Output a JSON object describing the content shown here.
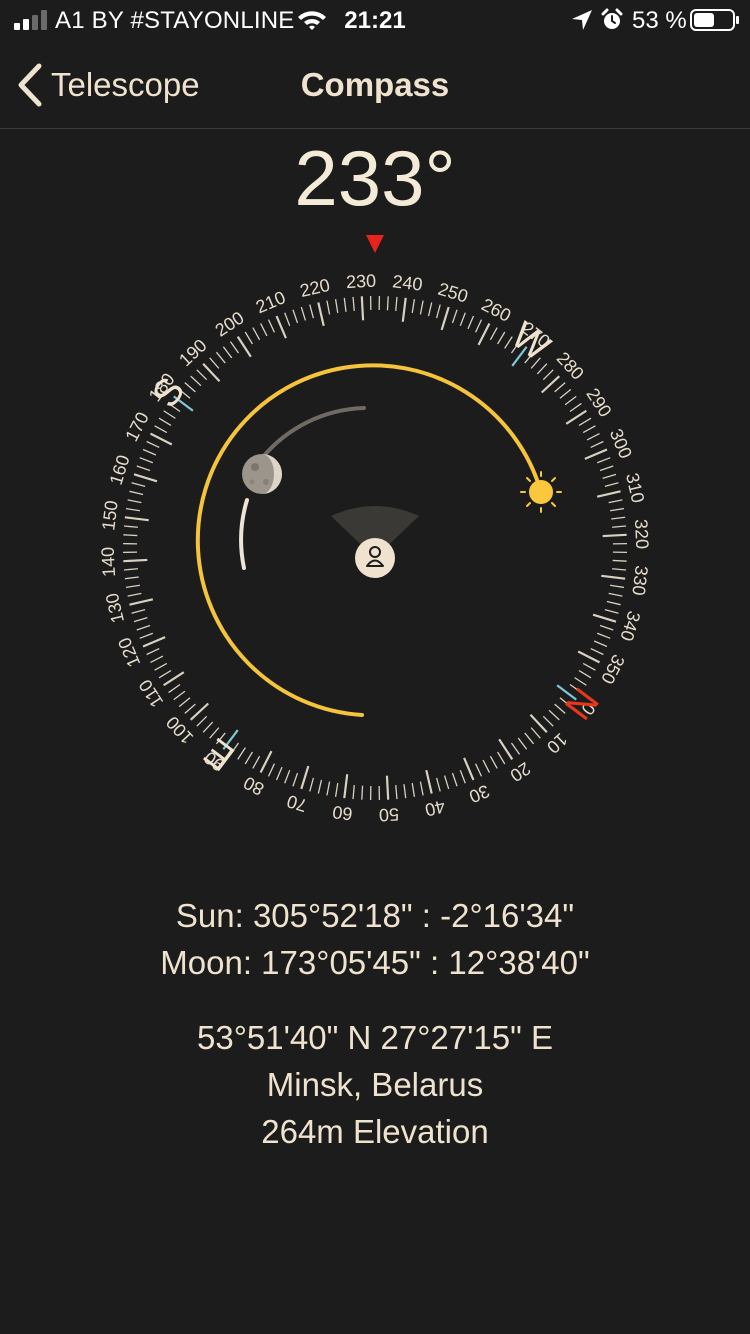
{
  "status_bar": {
    "carrier": "A1 BY #STAYONLINE",
    "time": "21:21",
    "battery_percent": "53 %",
    "battery_level": 0.53,
    "signal_bars": 2,
    "icons": [
      "signal-icon",
      "wifi-icon",
      "location-arrow-icon",
      "alarm-icon",
      "battery-icon"
    ]
  },
  "nav": {
    "back_label": "Telescope",
    "title": "Compass"
  },
  "heading": {
    "value": "233°",
    "degrees": 233
  },
  "compass": {
    "heading_degrees": 233,
    "tick_labels": [
      "0",
      "10",
      "20",
      "30",
      "40",
      "50",
      "60",
      "70",
      "80",
      "90",
      "100",
      "110",
      "120",
      "130",
      "140",
      "150",
      "160",
      "170",
      "180",
      "190",
      "200",
      "210",
      "220",
      "230",
      "240",
      "250",
      "260",
      "270",
      "280",
      "290",
      "300",
      "310",
      "320",
      "330",
      "340",
      "350"
    ],
    "cardinals": {
      "north": "N",
      "east": "E",
      "south": "S",
      "west": "W"
    },
    "sun_azimuth": 305.87,
    "moon_azimuth": 173.1,
    "colors": {
      "north": "#e8371b",
      "pointer": "#e8231b",
      "sun_path": "#f5c43a",
      "sun": "#fbc83d",
      "tick": "#d8d0c0",
      "label": "#e6dccb"
    },
    "icons": [
      "heading-pointer-icon",
      "sun-icon",
      "moon-icon",
      "user-location-icon"
    ]
  },
  "info": {
    "sun": "Sun: 305°52'18\" : -2°16'34\"",
    "moon": "Moon: 173°05'45\" : 12°38'40\"",
    "coordinates": "53°51'40\" N 27°27'15\" E",
    "place": "Minsk, Belarus",
    "elevation": "264m Elevation"
  }
}
